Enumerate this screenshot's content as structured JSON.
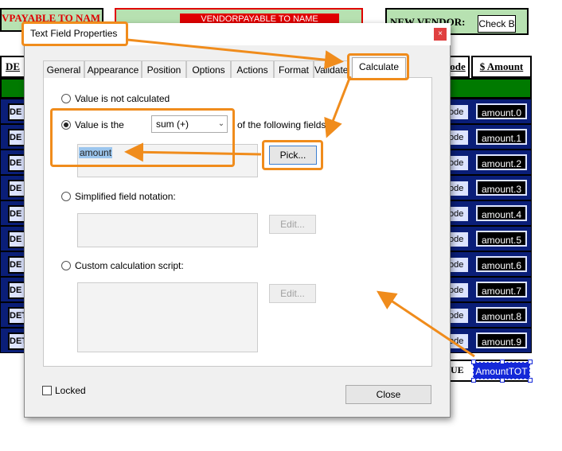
{
  "form": {
    "header_left": "VPAYABLE TO NAME",
    "header_mid": "VENDORPAYABLE TO NAME",
    "header_right": "NEW VENDOR:",
    "check_label": "Check B",
    "col_left_header": "DE",
    "col_code_header": "ode",
    "col_amount_header": "$ Amount",
    "rows": [
      {
        "left": "DE",
        "code": "ode",
        "amount": "amount.0"
      },
      {
        "left": "DE",
        "code": "ode",
        "amount": "amount.1"
      },
      {
        "left": "DE",
        "code": "ode",
        "amount": "amount.2"
      },
      {
        "left": "DE",
        "code": "ode",
        "amount": "amount.3"
      },
      {
        "left": "DE",
        "code": "ode",
        "amount": "amount.4"
      },
      {
        "left": "DE",
        "code": "ode",
        "amount": "amount.5"
      },
      {
        "left": "DE",
        "code": "ode",
        "amount": "amount.6"
      },
      {
        "left": "DE",
        "code": "ode",
        "amount": "amount.7"
      },
      {
        "left": "DET",
        "code": "ode",
        "amount": "amount.8"
      },
      {
        "left": "DET",
        "code": "ode",
        "amount": "amount.9"
      }
    ],
    "due_label": "UE",
    "total_field": "AmountTOT"
  },
  "dialog": {
    "title": "Text Field Properties",
    "close_glyph": "×",
    "tabs": [
      "General",
      "Appearance",
      "Position",
      "Options",
      "Actions",
      "Format",
      "Validate",
      "Calculate"
    ],
    "active_tab": "Calculate",
    "option_not_calculated": "Value is not calculated",
    "option_value_is": "Value is the",
    "operation_select": "sum (+)",
    "following_fields_text": "of the following fields",
    "fields_value": "amount",
    "pick_button": "Pick...",
    "option_simplified": "Simplified field notation:",
    "edit_button_1": "Edit...",
    "option_custom": "Custom calculation script:",
    "edit_button_2": "Edit...",
    "locked_label": "Locked",
    "close_button": "Close"
  },
  "colors": {
    "highlight": "#f08c1c",
    "row_band": "#0a1e78",
    "header_green": "#b7e1b1",
    "bar_green": "#007a00",
    "total_blue": "#1428d8"
  }
}
